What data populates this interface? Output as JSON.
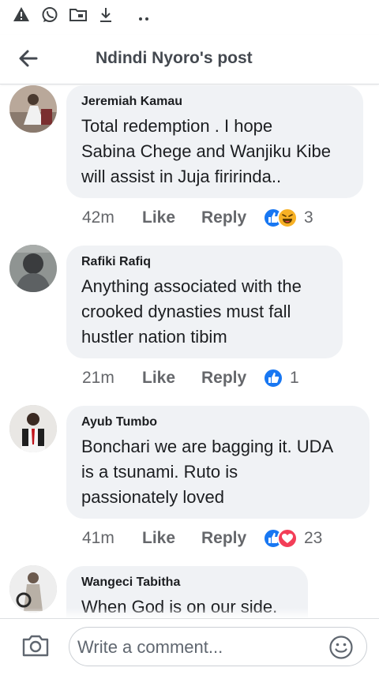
{
  "header": {
    "title": "Ndindi Nyoro's post"
  },
  "comments": [
    {
      "author": "Jeremiah Kamau",
      "text_lines": [
        "Total redemption . I hope",
        "Sabina Chege and Wanjiku Kibe",
        "will assist in Juja firirinda.."
      ],
      "time": "42m",
      "like": "Like",
      "reply": "Reply",
      "reactions": [
        "like",
        "haha"
      ],
      "count": "3"
    },
    {
      "author": "Rafiki Rafiq",
      "text_lines": [
        "Anything associated with the",
        "crooked dynasties must fall",
        "hustler nation tibim"
      ],
      "time": "21m",
      "like": "Like",
      "reply": "Reply",
      "reactions": [
        "like"
      ],
      "count": "1"
    },
    {
      "author": "Ayub Tumbo",
      "text_lines": [
        "Bonchari we are bagging it. UDA",
        "is a tsunami. Ruto is",
        "passionately loved"
      ],
      "time": "41m",
      "like": "Like",
      "reply": "Reply",
      "reactions": [
        "like",
        "love"
      ],
      "count": "23"
    },
    {
      "author": "Wangeci Tabitha",
      "text_lines": [
        "When God is on our side."
      ]
    }
  ],
  "composer": {
    "placeholder": "Write a comment..."
  },
  "colors": {
    "like_blue": "#1877f2",
    "love_red": "#f33e58",
    "haha_yellow": "#f7b125",
    "bubble_bg": "#f0f2f5",
    "meta_gray": "#65676b"
  },
  "icons": {
    "status": [
      "alert-triangle-icon",
      "whatsapp-icon",
      "folder-icon",
      "download-icon",
      "more-dots-icon"
    ],
    "back": "arrow-left-icon",
    "camera": "camera-icon",
    "emoji": "smiley-icon"
  }
}
